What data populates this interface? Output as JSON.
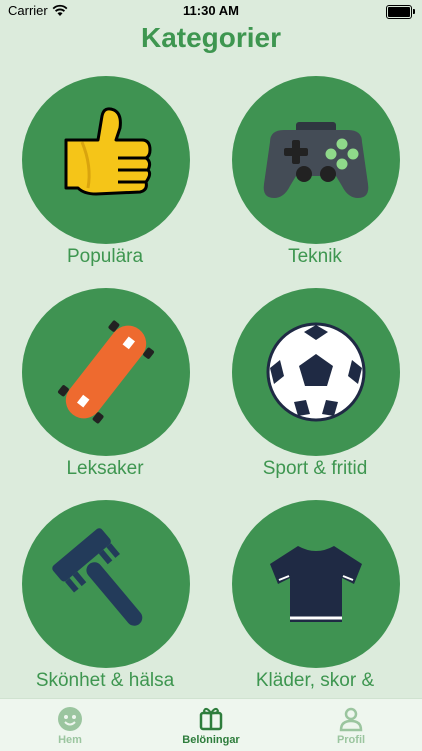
{
  "status_bar": {
    "carrier": "Carrier",
    "time": "11:30 AM"
  },
  "page": {
    "title": "Kategorier"
  },
  "categories": [
    {
      "label": "Populära",
      "icon": "thumbs-up-icon"
    },
    {
      "label": "Teknik",
      "icon": "gamepad-icon"
    },
    {
      "label": "Leksaker",
      "icon": "skateboard-icon"
    },
    {
      "label": "Sport & fritid",
      "icon": "soccer-ball-icon"
    },
    {
      "label": "Skönhet & hälsa",
      "icon": "comb-icon"
    },
    {
      "label": "Kläder, skor &",
      "icon": "tshirt-icon"
    }
  ],
  "tab_bar": {
    "items": [
      {
        "label": "Hem",
        "icon": "smiley-face-icon",
        "active": false
      },
      {
        "label": "Belöningar",
        "icon": "gift-icon",
        "active": true
      },
      {
        "label": "Profil",
        "icon": "person-icon",
        "active": false
      }
    ]
  },
  "colors": {
    "background": "#dcebdc",
    "accent": "#3e9650",
    "circle": "#3f9352",
    "tab_active": "#2e7d3c",
    "tab_inactive": "#9bc59f"
  }
}
